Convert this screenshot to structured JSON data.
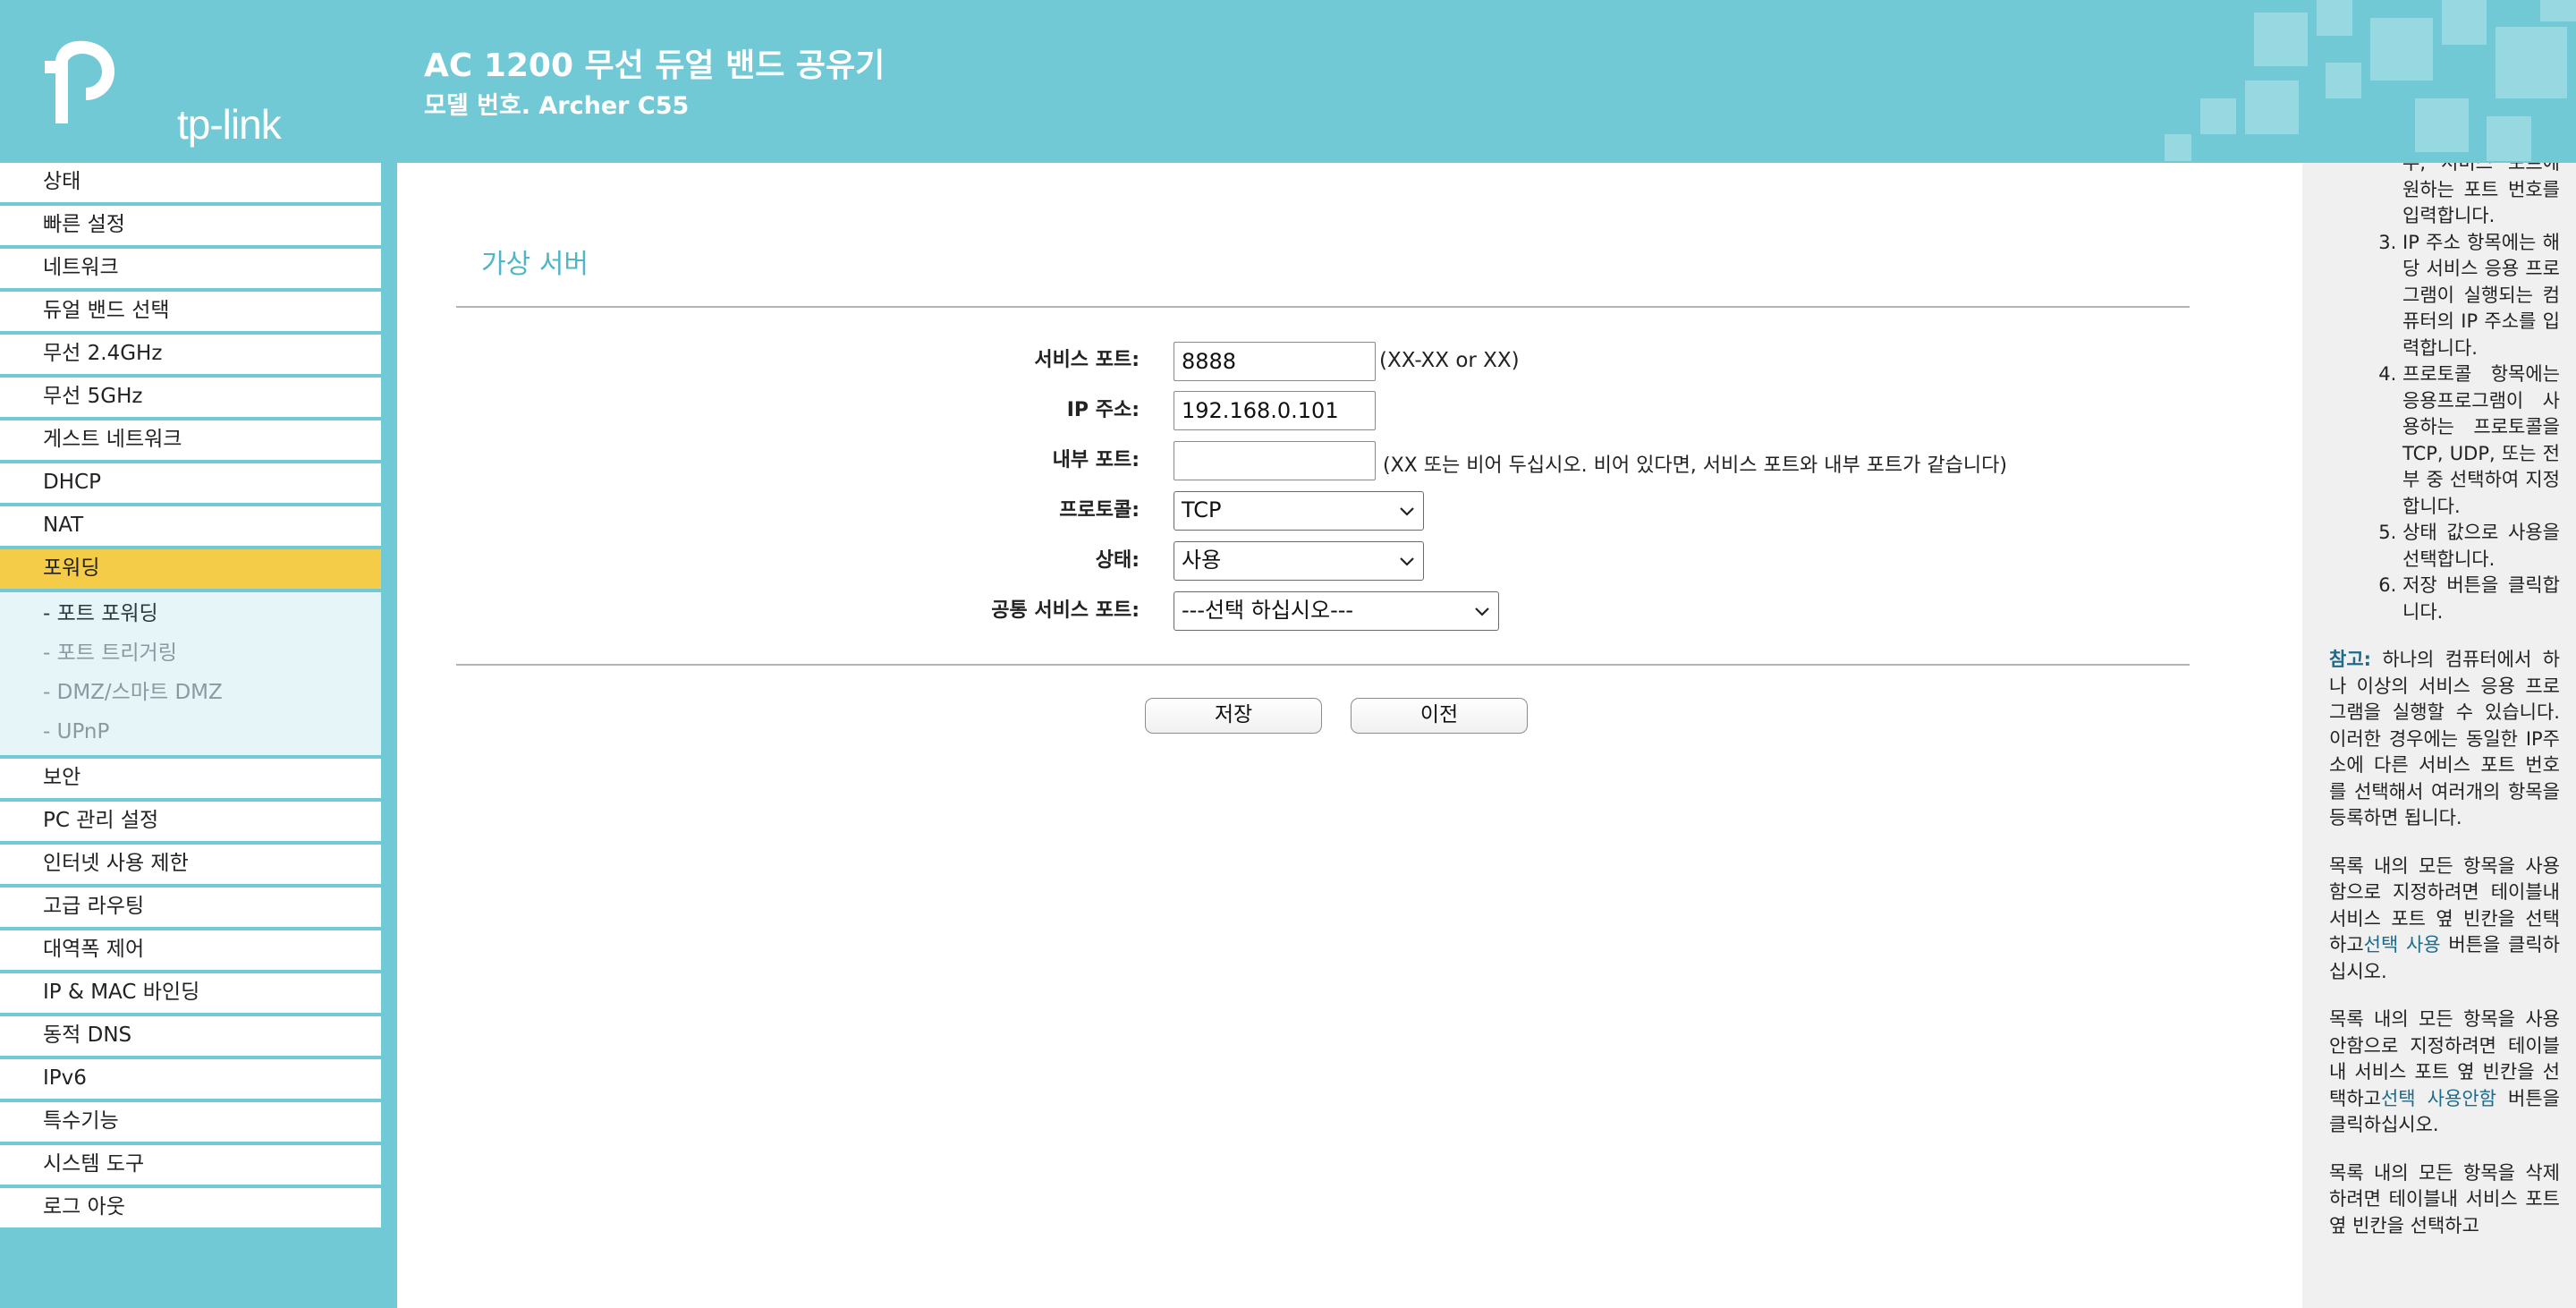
{
  "header": {
    "logo_text": "tp-link",
    "product_title": "AC 1200 무선 듀얼 밴드 공유기",
    "model_label": "모델 번호. Archer C55"
  },
  "sidebar": {
    "items_before": [
      {
        "label": "상태"
      },
      {
        "label": "빠른 설정"
      },
      {
        "label": "네트워크"
      },
      {
        "label": "듀얼 밴드 선택"
      },
      {
        "label": "무선 2.4GHz"
      },
      {
        "label": "무선 5GHz"
      },
      {
        "label": "게스트 네트워크"
      },
      {
        "label": "DHCP"
      },
      {
        "label": "NAT"
      }
    ],
    "active_item": {
      "label": "포워딩"
    },
    "sub_items": [
      {
        "label": "- 포트 포워딩"
      },
      {
        "label": "- 포트 트리거링"
      },
      {
        "label": "- DMZ/스마트 DMZ"
      },
      {
        "label": "- UPnP"
      }
    ],
    "items_after": [
      {
        "label": "보안"
      },
      {
        "label": "PC 관리 설정"
      },
      {
        "label": "인터넷 사용 제한"
      },
      {
        "label": "고급 라우팅"
      },
      {
        "label": "대역폭 제어"
      },
      {
        "label": "IP & MAC 바인딩"
      },
      {
        "label": "동적 DNS"
      },
      {
        "label": "IPv6"
      },
      {
        "label": "특수기능"
      },
      {
        "label": "시스템 도구"
      },
      {
        "label": "로그 아웃"
      }
    ]
  },
  "main": {
    "page_title": "가상 서버",
    "form": {
      "service_port": {
        "label": "서비스 포트:",
        "value": "8888",
        "hint": "(XX-XX or XX)"
      },
      "ip_address": {
        "label": "IP 주소:",
        "value": "192.168.0.101"
      },
      "internal_port": {
        "label": "내부 포트:",
        "value": "",
        "hint": "(XX 또는 비어 두십시오. 비어 있다면, 서비스 포트와 내부 포트가 같습니다)"
      },
      "protocol": {
        "label": "프로토콜:",
        "selected": "TCP"
      },
      "status": {
        "label": "상태:",
        "selected": "사용"
      },
      "common_service_port": {
        "label": "공통 서비스 포트:",
        "selected": "---선택 하십시오---"
      }
    },
    "buttons": {
      "save": "저장",
      "back": "이전"
    }
  },
  "help": {
    "item2_tail": "우, 서비스 포트에 원하는 포트 번호를 입력합니다.",
    "step3": "IP 주소 항목에는 해당 서비스 응용 프로그램이 실행되는 컴퓨터의 IP 주소를 입력합니다.",
    "step4": "프로토콜 항목에는 응용프로그램이 사용하는 프로토콜을 TCP, UDP, 또는 전부 중 선택하여 지정합니다.",
    "step5": "상태 값으로 사용을 선택합니다.",
    "step6": "저장 버튼을 클릭합니다.",
    "note_label": "참고:",
    "note_text": "하나의 컴퓨터에서 하나 이상의 서비스 응용 프로그램을 실행할 수 있습니다. 이러한 경우에는 동일한 IP주소에 다른 서비스 포트 번호를 선택해서 여러개의 항목을 등록하면 됩니다.",
    "para_enable_before": "목록 내의 모든 항목을 사용함으로 지정하려면 테이블내 서비스 포트 옆 빈칸을 선택하고",
    "para_enable_button": "선택 사용",
    "para_enable_after": " 버튼을 클릭하십시오.",
    "para_disable_before": "목록 내의 모든 항목을 사용안함으로 지정하려면 테이블내 서비스 포트 옆 빈칸을 선택하고",
    "para_disable_button": "선택 사용안함",
    "para_disable_after": " 버튼을 클릭하십시오.",
    "para_delete": "목록 내의 모든 항목을 삭제하려면 테이블내 서비스 포트 옆 빈칸을 선택하고"
  },
  "colors": {
    "brand_teal": "#71c9d5",
    "active_menu": "#f5cc48",
    "title_teal": "#4fb6c7"
  },
  "icons": {
    "logo": "tp-link-logo-icon",
    "dropdown": "chevron-down-icon"
  }
}
